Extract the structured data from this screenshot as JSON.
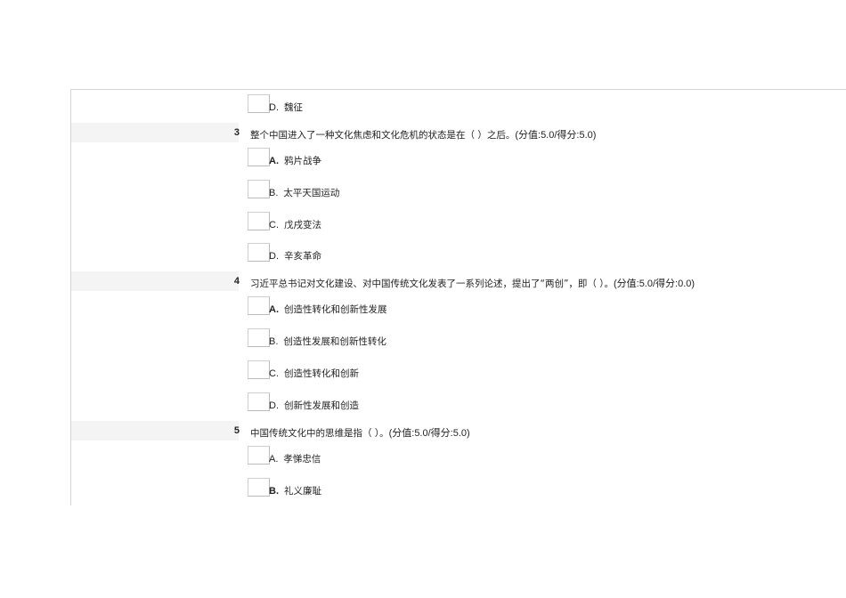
{
  "items": [
    {
      "type": "option",
      "letter": "D.",
      "text": "魏征",
      "correct": false
    },
    {
      "type": "question",
      "number": "3",
      "text": "整个中国进入了一种文化焦虑和文化危机的状态是在（  ）之后。",
      "score": "(分值:5.0/得分:5.0)"
    },
    {
      "type": "option",
      "letter": "A.",
      "text": "鸦片战争",
      "correct": true
    },
    {
      "type": "option",
      "letter": "B.",
      "text": "太平天国运动",
      "correct": false
    },
    {
      "type": "option",
      "letter": "C.",
      "text": "戊戌变法",
      "correct": false
    },
    {
      "type": "option",
      "letter": "D.",
      "text": "辛亥革命",
      "correct": false
    },
    {
      "type": "question",
      "number": "4",
      "text": "习近平总书记对文化建设、对中国传统文化发表了一系列论述，提出了“两创”，即（  ）。",
      "score": "(分值:5.0/得分:0.0)"
    },
    {
      "type": "option",
      "letter": "A.",
      "text": "创造性转化和创新性发展",
      "correct": true
    },
    {
      "type": "option",
      "letter": "B.",
      "text": "创造性发展和创新性转化",
      "correct": false
    },
    {
      "type": "option",
      "letter": "C.",
      "text": "创造性转化和创新",
      "correct": false
    },
    {
      "type": "option",
      "letter": "D.",
      "text": "创新性发展和创造",
      "correct": false
    },
    {
      "type": "question",
      "number": "5",
      "text": "中国传统文化中的思维是指（  ）。",
      "score": "(分值:5.0/得分:5.0)"
    },
    {
      "type": "option",
      "letter": "A.",
      "text": "孝悌忠信",
      "correct": false
    },
    {
      "type": "option",
      "letter": "B.",
      "text": "礼义廉耻",
      "correct": true
    }
  ]
}
